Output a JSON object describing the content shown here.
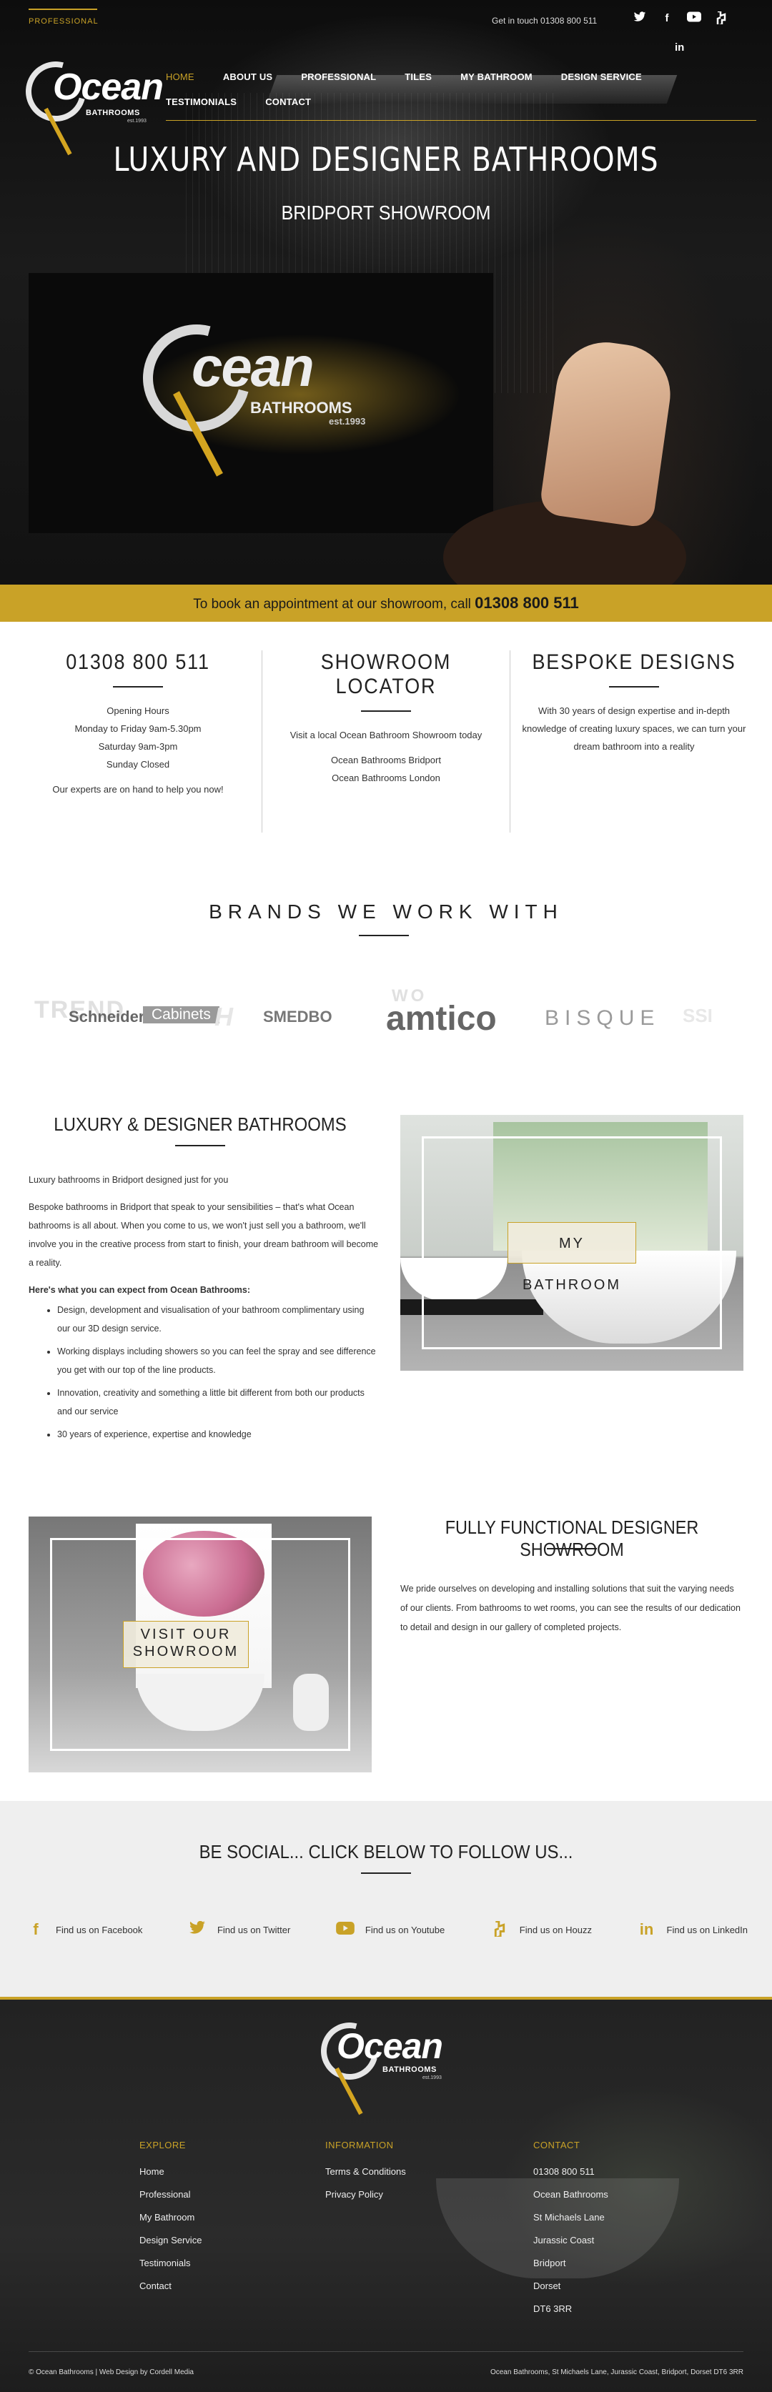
{
  "header": {
    "professional_tab": "PROFESSIONAL",
    "get_in_touch": "Get in touch 01308 800 511",
    "social_icons": [
      "twitter-icon",
      "facebook-icon",
      "youtube-icon",
      "houzz-icon",
      "linkedin-icon"
    ],
    "logo": {
      "word": "Ocean",
      "sub": "BATHROOMS",
      "est": "est.1993"
    },
    "nav": [
      "HOME",
      "ABOUT US",
      "PROFESSIONAL",
      "TILES",
      "MY BATHROOM",
      "DESIGN SERVICE",
      "TESTIMONIALS",
      "CONTACT"
    ],
    "active_nav": "HOME"
  },
  "hero": {
    "title": "LUXURY AND DESIGNER BATHROOMS",
    "subtitle": "BRIDPORT SHOWROOM",
    "video_logo": {
      "word": "cean",
      "sub": "BATHROOMS",
      "est": "est.1993"
    }
  },
  "booking": {
    "text": "To book an appointment at our showroom, call ",
    "phone": "01308 800 511"
  },
  "info": {
    "phone_col": {
      "title": "01308 800 511",
      "lines": [
        "Opening Hours",
        "Monday to Friday 9am-5.30pm",
        "Saturday 9am-3pm",
        "Sunday Closed"
      ],
      "note": "Our experts are on hand to help you now!"
    },
    "locator_col": {
      "title": "SHOWROOM LOCATOR",
      "intro": "Visit a local Ocean Bathroom Showroom today",
      "links": [
        "Ocean Bathrooms Bridport",
        "Ocean Bathrooms London"
      ]
    },
    "bespoke_col": {
      "title": "BESPOKE DESIGNS",
      "text": "With 30 years of design expertise and in-depth knowledge of creating luxury spaces, we can turn your dream bathroom into a reality"
    }
  },
  "brands": {
    "title": "BRANDS WE WORK WITH",
    "logos": [
      "TREND",
      "Schneider",
      "Cabinets",
      "H",
      "SMEDBO",
      "amtico",
      "WO",
      "BISQUE",
      "SSI"
    ]
  },
  "luxury": {
    "title": "LUXURY & DESIGNER BATHROOMS",
    "intro": "Luxury bathrooms in Bridport designed just for you",
    "body": "Bespoke bathrooms in Bridport that speak to your sensibilities – that's what Ocean bathrooms is all about. When you come to us, we won't just sell you a bathroom, we'll involve you in the creative process from start to finish, your dream bathroom will become a reality.",
    "expect_heading": "Here's what you can expect from Ocean Bathrooms:",
    "bullets": [
      "Design, development and visualisation of your bathroom complimentary using our our 3D design service.",
      "Working displays including showers so you can feel the spray and see difference you get with our top of the line products.",
      "Innovation, creativity and something a little bit different from both our products and our service",
      "30 years of experience, expertise and knowledge"
    ],
    "image_label": "MY BATHROOM"
  },
  "showroom": {
    "image_label_line1": "VISIT OUR",
    "image_label_line2": "SHOWROOM",
    "title": "FULLY FUNCTIONAL DESIGNER SHOWROOM",
    "text": "We pride ourselves on developing and installing solutions that suit the varying needs of our clients. From bathrooms to wet rooms, you can see the results of our dedication to detail and design in our gallery of completed projects."
  },
  "social": {
    "title": "BE SOCIAL... CLICK BELOW TO FOLLOW US...",
    "items": [
      {
        "icon": "facebook-icon",
        "label": "Find us on Facebook"
      },
      {
        "icon": "twitter-icon",
        "label": "Find us on Twitter"
      },
      {
        "icon": "youtube-icon",
        "label": "Find us on Youtube"
      },
      {
        "icon": "houzz-icon",
        "label": "Find us on Houzz"
      },
      {
        "icon": "linkedin-icon",
        "label": "Find us on LinkedIn"
      }
    ]
  },
  "footer": {
    "logo": {
      "word": "Ocean",
      "sub": "BATHROOMS",
      "est": "est.1993"
    },
    "explore_title": "EXPLORE",
    "explore": [
      "Home",
      "Professional",
      "My Bathroom",
      "Design Service",
      "Testimonials",
      "Contact"
    ],
    "information_title": "INFORMATION",
    "information": [
      "Terms & Conditions",
      "Privacy Policy"
    ],
    "contact_title": "CONTACT",
    "contact": [
      "01308 800 511",
      "Ocean Bathrooms",
      "St Michaels Lane",
      "Jurassic Coast",
      "Bridport",
      "Dorset",
      "DT6 3RR"
    ],
    "copyright": "© Ocean Bathrooms | Web Design by Cordell Media",
    "address": "Ocean Bathrooms, St Michaels Lane, Jurassic Coast, Bridport, Dorset DT6 3RR"
  },
  "colors": {
    "accent_gold": "#c9a227",
    "dark": "#111111",
    "light_grey": "#efefef"
  }
}
